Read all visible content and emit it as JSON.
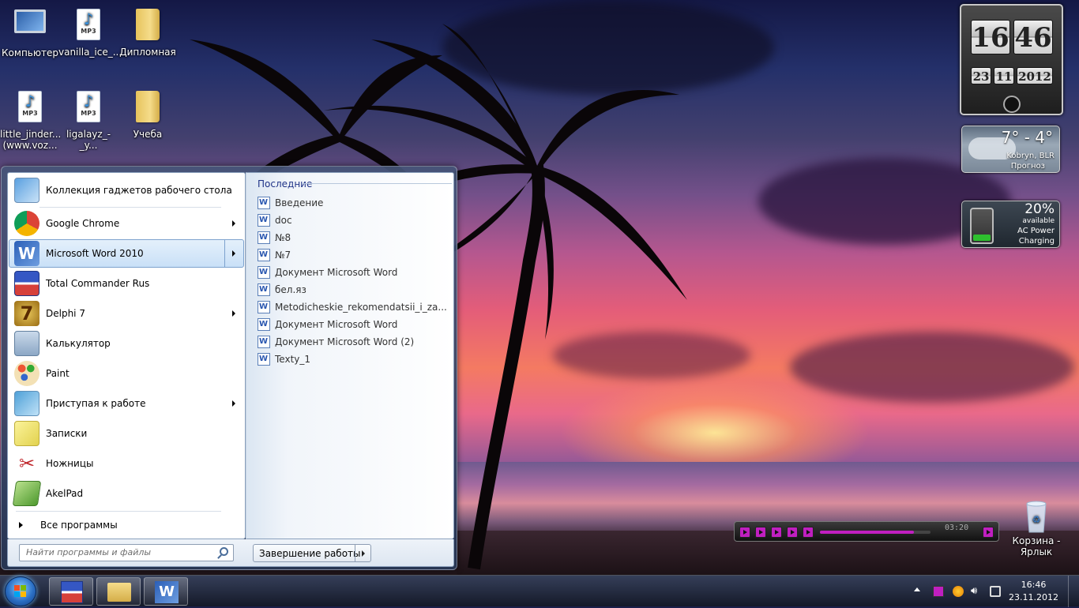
{
  "desktop_icons": [
    {
      "label": "Компьютер",
      "type": "computer"
    },
    {
      "label": "vanilla_ice_...",
      "type": "mp3"
    },
    {
      "label": "Дипломная",
      "type": "folder"
    },
    {
      "label": "little_jinder...",
      "label2": "(www.voz...",
      "type": "mp3"
    },
    {
      "label": "ligalayz_-_y...",
      "type": "mp3"
    },
    {
      "label": "Учеба",
      "type": "folder"
    },
    {
      "label": "Корзина -",
      "label2": "Ярлык",
      "type": "recycle-bin"
    }
  ],
  "mp3_badge": "MP3",
  "start_menu": {
    "programs": [
      {
        "label": "Коллекция гаджетов рабочего стола",
        "has_submenu": false
      },
      {
        "label": "Google Chrome",
        "has_submenu": true
      },
      {
        "label": "Microsoft Word 2010",
        "has_submenu": true,
        "selected": true
      },
      {
        "label": "Total Commander Rus",
        "has_submenu": false
      },
      {
        "label": "Delphi 7",
        "has_submenu": true
      },
      {
        "label": "Калькулятор",
        "has_submenu": false
      },
      {
        "label": "Paint",
        "has_submenu": false
      },
      {
        "label": "Приступая к работе",
        "has_submenu": true
      },
      {
        "label": "Записки",
        "has_submenu": false
      },
      {
        "label": "Ножницы",
        "has_submenu": false
      },
      {
        "label": "AkelPad",
        "has_submenu": false
      }
    ],
    "all_programs": "Все программы",
    "search_placeholder": "Найти программы и файлы",
    "shutdown_label": "Завершение работы",
    "recent_header": "Последние",
    "recent_items": [
      "Введение",
      "doc",
      "№8",
      "№7",
      "Документ Microsoft Word",
      "бел.яз",
      "Metodicheskie_rekomendatsii_i_za...",
      "Документ Microsoft Word",
      "Документ Microsoft Word (2)",
      "Texty_1"
    ]
  },
  "gadgets": {
    "clock": {
      "hour": "16",
      "minute": "46",
      "day": "23",
      "month": "11",
      "year": "2012"
    },
    "weather": {
      "temp": "7° - 4°",
      "location": "Kobryn, BLR",
      "forecast": "Прогноз"
    },
    "battery": {
      "percent": "20%",
      "status": "available",
      "power": "AC Power",
      "charging": "Charging",
      "level_fraction": 0.2
    }
  },
  "media_player": {
    "time": "03:20",
    "progress_fraction": 0.85
  },
  "taskbar": {
    "time": "16:46",
    "date": "23.11.2012",
    "pinned": [
      "total-commander",
      "explorer",
      "word"
    ]
  },
  "colors": {
    "accent": "#c01fc0",
    "selection": "#c9e0f7",
    "recent_header": "#1e3287"
  }
}
